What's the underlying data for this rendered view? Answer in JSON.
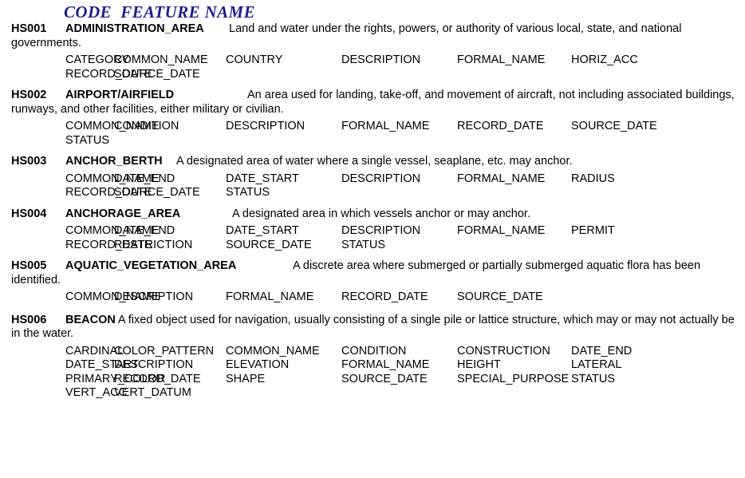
{
  "document": {
    "title": "CODE  FEATURE NAME",
    "title_color": "#1d1d8f"
  },
  "attribute_columns": 6,
  "features": [
    {
      "code": "HS001",
      "name": "ADMINISTRATION_AREA",
      "description": "Land and water under the rights, powers, or authority of various local, state, and national governments.",
      "attributes": [
        "CATEGORY",
        "COMMON_NAME",
        "COUNTRY",
        "DESCRIPTION",
        "FORMAL_NAME",
        "HORIZ_ACC",
        "RECORD_DATE",
        "SOURCE_DATE"
      ]
    },
    {
      "code": "HS002",
      "name": "AIRPORT/AIRFIELD",
      "description": "An area used for landing, take-off, and movement of aircraft, not including associated buildings, runways, and other facilities, either military or civilian.",
      "attributes": [
        "COMMON_NAME",
        "CONDITION",
        "DESCRIPTION",
        "FORMAL_NAME",
        "RECORD_DATE",
        "SOURCE_DATE",
        "STATUS"
      ]
    },
    {
      "code": "HS003",
      "name": "ANCHOR_BERTH",
      "description": "A designated area of water where a single vessel, seaplane, etc. may anchor.",
      "attributes": [
        "COMMON_NAME",
        "DATE_END",
        "DATE_START",
        "DESCRIPTION",
        "FORMAL_NAME",
        "RADIUS",
        "RECORD_DATE",
        "SOURCE_DATE",
        "STATUS"
      ]
    },
    {
      "code": "HS004",
      "name": "ANCHORAGE_AREA",
      "description": "A designated area in which vessels anchor or may anchor.",
      "attributes": [
        "COMMON_NAME",
        "DATE_END",
        "DATE_START",
        "DESCRIPTION",
        "FORMAL_NAME",
        "PERMIT",
        "RECORD_DATE",
        "RESTRICTION",
        "SOURCE_DATE",
        "STATUS"
      ]
    },
    {
      "code": "HS005",
      "name": "AQUATIC_VEGETATION_AREA",
      "description": "A discrete area where submerged or partially submerged aquatic flora has been identified.",
      "attributes": [
        "COMMON_NAME",
        "DESCRIPTION",
        "FORMAL_NAME",
        "RECORD_DATE",
        "SOURCE_DATE"
      ]
    },
    {
      "code": "HS006",
      "name": "BEACON",
      "description": "A fixed object used for navigation, usually consisting of a single pile or lattice structure, which may or may not actually be in the water.",
      "attributes": [
        "CARDINAL",
        "COLOR_PATTERN",
        "COMMON_NAME",
        "CONDITION",
        "CONSTRUCTION",
        "DATE_END",
        "DATE_START",
        "DESCRIPTION",
        "ELEVATION",
        "FORMAL_NAME",
        "HEIGHT",
        "LATERAL",
        "PRIMARY_COLOR",
        "RECORD_DATE",
        "SHAPE",
        "SOURCE_DATE",
        "SPECIAL_PURPOSE",
        "STATUS",
        "VERT_ACC",
        "VERT_DATUM"
      ]
    }
  ]
}
